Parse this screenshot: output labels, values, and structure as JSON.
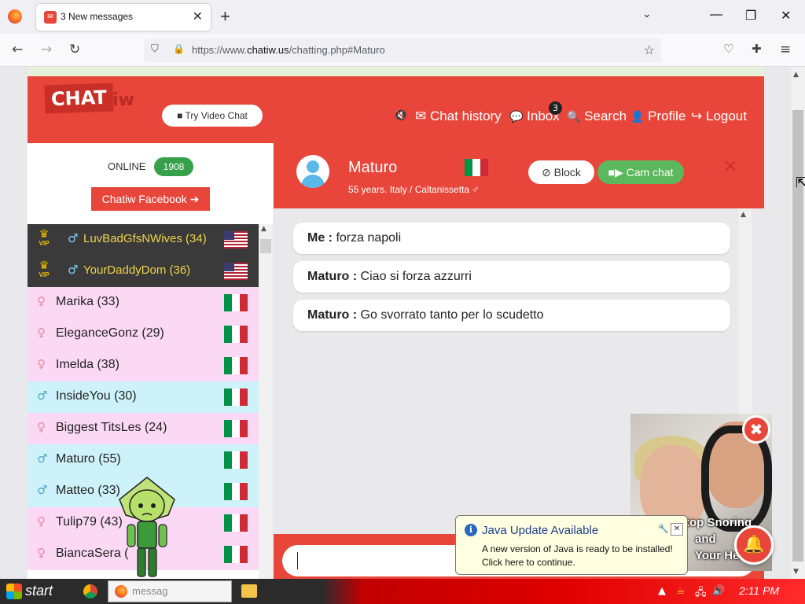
{
  "browser": {
    "tab_title": "3 New messages",
    "tab_favicon": "✉",
    "url_prefix": "https://www.",
    "url_domain": "chatiw.us",
    "url_suffix": "/chatting.php#Maturo"
  },
  "header": {
    "logo_main": "CHAT",
    "logo_sub": "iw",
    "video_chat_label": "Try Video Chat",
    "mute_icon": "🔇",
    "nav": [
      {
        "icon": "✉",
        "label": "Chat history"
      },
      {
        "icon": "💬",
        "label": "Inbox"
      },
      {
        "icon": "🔍",
        "label": "Search"
      },
      {
        "icon": "👤",
        "label": "Profile"
      },
      {
        "icon": "↪",
        "label": "Logout"
      }
    ],
    "inbox_badge": "3"
  },
  "sidebar": {
    "online_label": "ONLINE",
    "online_count": "1908",
    "facebook_label": "Chatiw Facebook ➔",
    "vip_label": "VIP",
    "users": [
      {
        "name": "LuvBadGfsNWives (34)",
        "type": "vip",
        "symbol": "♂",
        "flag": "us"
      },
      {
        "name": "YourDaddyDom (36)",
        "type": "vip",
        "symbol": "♂",
        "flag": "us"
      },
      {
        "name": "Marika (33)",
        "type": "female",
        "symbol": "♀",
        "flag": "it"
      },
      {
        "name": "EleganceGonz (29)",
        "type": "female",
        "symbol": "♀",
        "flag": "it"
      },
      {
        "name": "Imelda (38)",
        "type": "female",
        "symbol": "♀",
        "flag": "it"
      },
      {
        "name": "InsideYou (30)",
        "type": "male",
        "symbol": "♂",
        "flag": "it"
      },
      {
        "name": "Biggest TitsLes (24)",
        "type": "female",
        "symbol": "♀",
        "flag": "it"
      },
      {
        "name": "Maturo (55)",
        "type": "male",
        "symbol": "♂",
        "flag": "it"
      },
      {
        "name": "Matteo (33)",
        "type": "male",
        "symbol": "♂",
        "flag": "it"
      },
      {
        "name": "Tulip79 (43)",
        "type": "female",
        "symbol": "♀",
        "flag": "it"
      },
      {
        "name": "BiancaSera (",
        "type": "female",
        "symbol": "♀",
        "flag": "it"
      }
    ]
  },
  "chat": {
    "partner_name": "Maturo",
    "partner_info": "55 years. Italy / Caltanissetta ♂",
    "block_label": "⊘ Block",
    "cam_label": "■▶ Cam chat",
    "close_icon": "✕",
    "messages": [
      {
        "sender": "Me :",
        "text": " forza napoli"
      },
      {
        "sender": "Maturo :",
        "text": " Ciao si forza azzurri"
      },
      {
        "sender": "Maturo :",
        "text": " Go svorrato tanto per lo scudetto"
      }
    ]
  },
  "ad": {
    "lines": [
      "top Snoring",
      "and",
      "Your Hea"
    ],
    "close_icon": "✖",
    "bell_icon": "🔔"
  },
  "java_balloon": {
    "title": "Java Update Available",
    "text": "A new version of Java is ready to be installed! Click here to continue.",
    "close_icon": "✕"
  },
  "taskbar": {
    "start_label": "start",
    "task_label": "messag",
    "clock": "2:11 PM"
  }
}
